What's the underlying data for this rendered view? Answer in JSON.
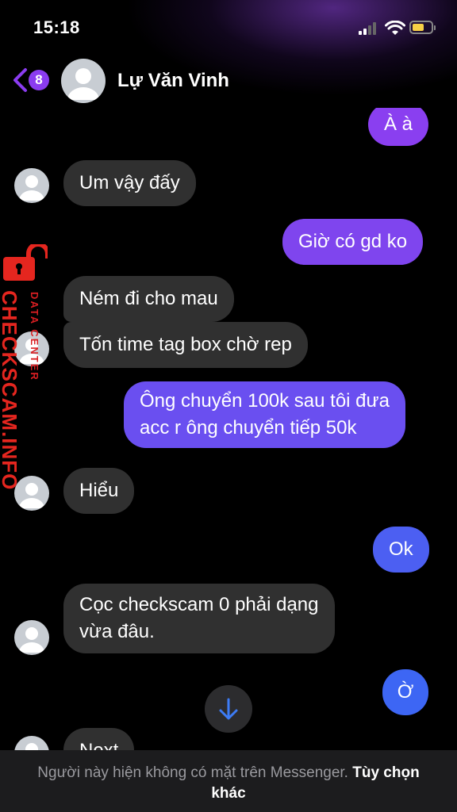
{
  "status_bar": {
    "time": "15:18",
    "battery_color": "#f7d046"
  },
  "header": {
    "back_badge": "8",
    "contact_name": "Lự Văn Vinh",
    "accent_color": "#8b3cf0"
  },
  "watermark": {
    "line1": "DATA CENTER",
    "line2": "CHECKSCAM.INFO"
  },
  "messages": [
    {
      "side": "out",
      "text": "À à",
      "color": "#8a3ff0"
    },
    {
      "side": "in",
      "text": "Um vậy đấy"
    },
    {
      "side": "out",
      "text": "Giờ có gd ko",
      "color": "#7f45ee"
    },
    {
      "side": "in",
      "text": "Ném đi cho mau"
    },
    {
      "side": "in",
      "text": "Tốn time tag box chờ rep"
    },
    {
      "side": "out",
      "lines": [
        "Ông chuyển 100k sau tôi đưa",
        "acc r ông chuyển tiếp 50k"
      ],
      "color": "#6a4ff0"
    },
    {
      "side": "in",
      "text": "Hiểu"
    },
    {
      "side": "out",
      "text": "Ok",
      "color": "#4c5ff2"
    },
    {
      "side": "in",
      "lines": [
        "Cọc checkscam 0 phải dạng",
        "vừa đâu."
      ]
    },
    {
      "side": "out",
      "text": "Ờ",
      "color": "#3d66f4"
    },
    {
      "side": "in",
      "text": "Next"
    }
  ],
  "footer": {
    "message": "Người này hiện không có mặt trên Messenger.",
    "link": "Tùy chọn khác"
  },
  "icons": {
    "back": "chevron-left-icon",
    "scroll": "arrow-down-icon",
    "signal": "signal-icon",
    "wifi": "wifi-icon",
    "battery": "battery-icon"
  }
}
